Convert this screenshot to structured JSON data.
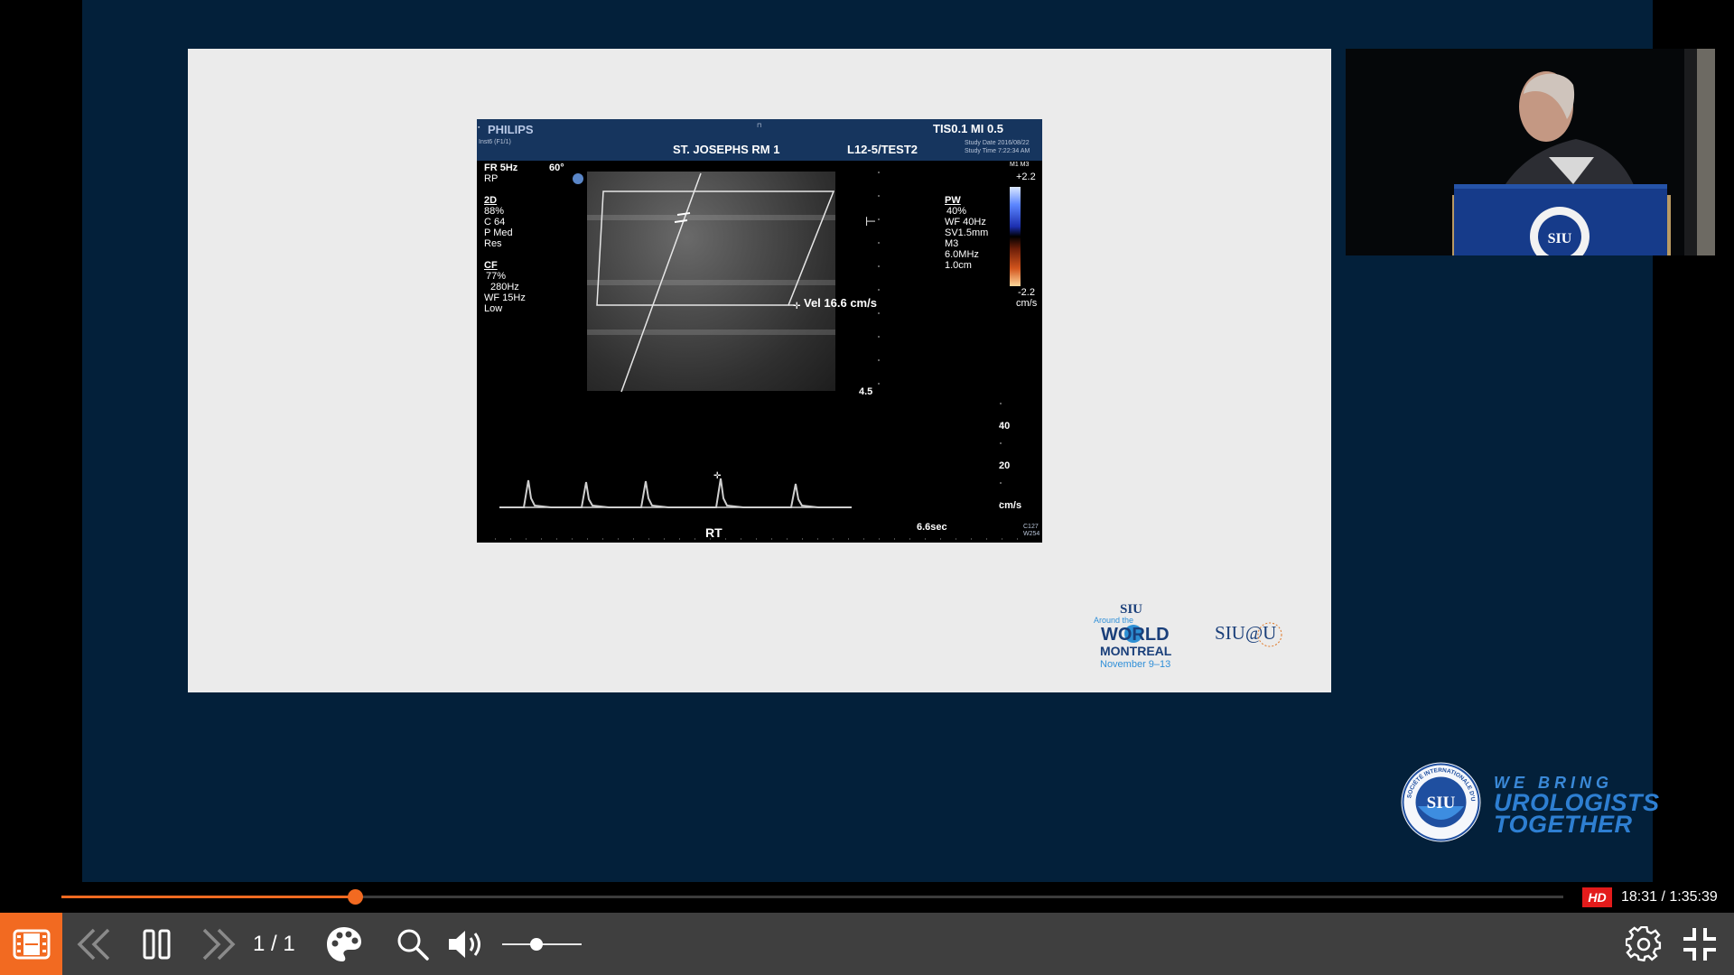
{
  "slide": {
    "ultrasound": {
      "brand": "PHILIPS",
      "brand_sub": "Inst6 (F1/1)",
      "top_marker": "⊓",
      "tis_mi": "TIS0.1   MI 0.5",
      "facility": "ST. JOSEPHS RM 1",
      "probe": "L12-5/TEST2",
      "study_date": "Study Date 2016/08/22",
      "study_time": "Study Time 7:22:34 AM",
      "params_row1": "FR 5Hz",
      "angle": "60°",
      "rp": "RP",
      "twod_header": "2D",
      "twod_lines": [
        "88%",
        "C 64",
        "P Med",
        "Res"
      ],
      "cf_header": "CF",
      "cf_lines": [
        "77%",
        "280Hz",
        "WF 15Hz",
        "Low"
      ],
      "pw_header": "PW",
      "pw_lines": [
        "40%",
        "WF 40Hz",
        "SV1.5mm",
        "M3",
        "6.0MHz",
        "1.0cm"
      ],
      "color_scale_top_label": "M1 M3",
      "color_scale_top": "+2.2",
      "color_scale_bottom": "-2.2",
      "color_scale_unit": "cm/s",
      "velocity": "Vel  16.6 cm/s",
      "depth": "4.5",
      "scale_40": "40",
      "scale_20": "20",
      "scale_unit": "cm/s",
      "side_label": "RT",
      "sweep": "6.6sec",
      "corner_code_1": "C127",
      "corner_code_2": "W254"
    },
    "logo_world": {
      "siu": "SIU",
      "around_the": "Around the",
      "world": "WORLD",
      "city": "MONTREAL",
      "dates": "November 9–13"
    },
    "logo_siuatu": "SIU@U"
  },
  "branding": {
    "seal_text": "SIU",
    "seal_ring": "SOCIÉTÉ INTERNATIONALE D'UROLOGIE",
    "line1": "WE BRING",
    "line2": "UROLOGISTS",
    "line3": "TOGETHER"
  },
  "player": {
    "progress_fraction": 0.1957,
    "hd_label": "HD",
    "time": "18:31 / 1:35:39",
    "page_indicator": "1 / 1",
    "volume_fraction": 0.43,
    "accent_color": "#f26a21"
  },
  "icons": [
    "film-strip-icon",
    "rewind-icon",
    "pause-icon",
    "fast-forward-icon",
    "palette-icon",
    "search-icon",
    "volume-icon",
    "settings-gear-icon",
    "exit-fullscreen-icon"
  ]
}
